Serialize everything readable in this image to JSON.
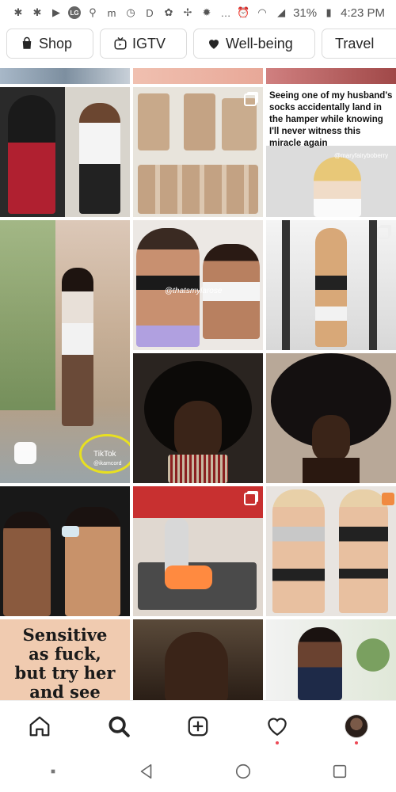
{
  "status_bar": {
    "battery": "31%",
    "time": "4:23 PM",
    "carrier_badge": "LG"
  },
  "chips": [
    {
      "label": "Shop",
      "icon": "shopping-bag-icon"
    },
    {
      "label": "IGTV",
      "icon": "igtv-icon"
    },
    {
      "label": "Well-being",
      "icon": "heart-icon"
    },
    {
      "label": "Travel",
      "icon": ""
    }
  ],
  "grid": {
    "meme_text": "Seeing one of my husband's socks accidentally land in the hamper while knowing I'll never witness this miracle again",
    "meme_watermark": "@maryfairyboberry",
    "photo_watermark_1": "@thatsmylarose",
    "tiktok_label": "TikTok",
    "tiktok_user": "@ikamcord",
    "quote_lines": [
      "Sensitive",
      "as fuck,",
      "but try her",
      "and see"
    ]
  },
  "bottom_nav": [
    {
      "name": "home",
      "icon": "home-icon"
    },
    {
      "name": "search",
      "icon": "search-icon"
    },
    {
      "name": "new-post",
      "icon": "plus-square-icon"
    },
    {
      "name": "activity",
      "icon": "heart-outline-icon"
    },
    {
      "name": "profile",
      "icon": "avatar"
    }
  ],
  "colors": {
    "accent_red": "#ed4956",
    "border": "#dbdbdb",
    "text": "#262626"
  }
}
